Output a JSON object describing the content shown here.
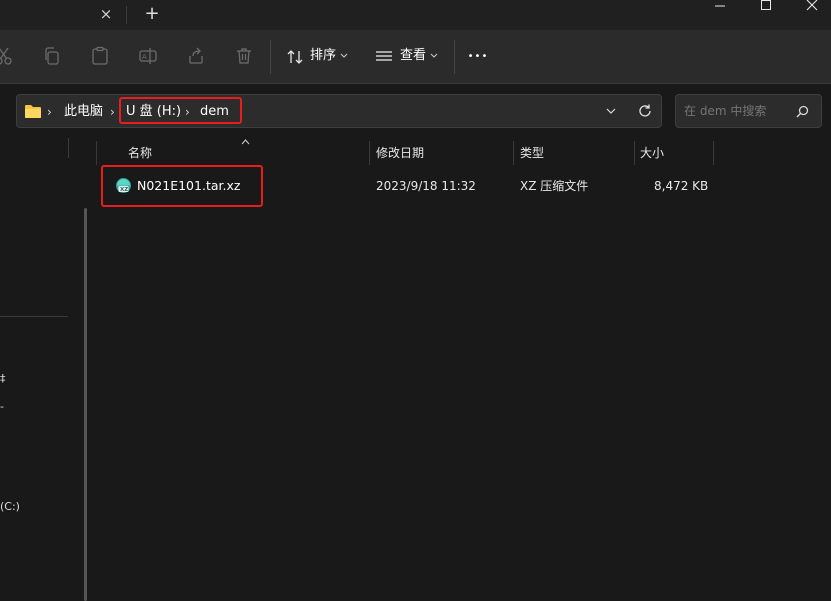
{
  "window": {
    "tab_close": "×",
    "tab_new": "+"
  },
  "toolbar": {
    "sort_label": "排序",
    "view_label": "查看",
    "more_label": "•••"
  },
  "address": {
    "crumbs": [
      "此电脑",
      "U 盘 (H:)",
      "dem"
    ]
  },
  "search": {
    "placeholder": "在 dem 中搜索"
  },
  "nav": {
    "items": [
      "‡",
      "-",
      "(C:)"
    ]
  },
  "columns": [
    "名称",
    "修改日期",
    "类型",
    "大小"
  ],
  "files": [
    {
      "name": "N021E101.tar.xz",
      "modified": "2023/9/18 11:32",
      "type": "XZ 压缩文件",
      "size": "8,472 KB"
    }
  ],
  "colors": {
    "highlight": "#e81d1d",
    "background": "#191919",
    "toolbar": "#2b2b2b",
    "folder": "#f5c445"
  }
}
